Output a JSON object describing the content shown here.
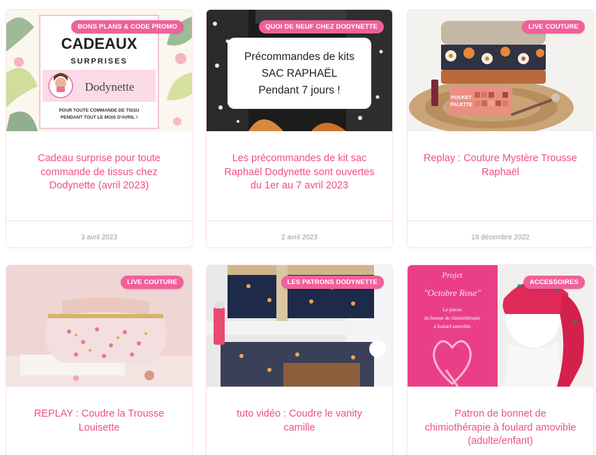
{
  "posts": [
    {
      "category": "BONS PLANS & CODE PROMO",
      "title": "Cadeau surprise pour toute commande de tissus chez Dodynette (avril 2023)",
      "date": "3 avril 2023",
      "image": {
        "heading": "CADEAUX",
        "subheading": "SURPRISES",
        "brand": "Dodynette",
        "line1": "POUR TOUTE COMMANDE DE TISSU",
        "line2": "PENDANT TOUT LE MOIS D'AVRIL !"
      }
    },
    {
      "category": "QUOI DE NEUF CHEZ DODYNETTE",
      "title": "Les précommandes de kit sac Raphaël Dodynette sont ouvertes du 1er au 7 avril 2023",
      "date": "2 avril 2023",
      "image": {
        "line1": "Précommandes de kits",
        "line2": "SAC RAPHAËL",
        "line3": "Pendant 7 jours !"
      }
    },
    {
      "category": "LIVE COUTURE",
      "title": "Replay : Couture Mystère Trousse Raphaël",
      "date": "18 décembre 2022",
      "image": {
        "palette_line1": "POCKET",
        "palette_line2": "PALETTE"
      }
    },
    {
      "category": "LIVE COUTURE",
      "title": "REPLAY : Coudre la Trousse Louisette",
      "date": "",
      "image": {}
    },
    {
      "category": "LES PATRONS DODYNETTE",
      "title": "tuto vidéo : Coudre le vanity camille",
      "date": "",
      "image": {}
    },
    {
      "category": "ACCESSOIRES",
      "title": "Patron de bonnet de chimiothérapie à foulard amovible (adulte/enfant)",
      "date": "",
      "image": {
        "line1": "Projet",
        "line2": "\"Octobre Rose\"",
        "line3": "Le patron",
        "line4": "du bonnet de chimiothérapie",
        "line5": "à foulard amovible"
      }
    }
  ]
}
